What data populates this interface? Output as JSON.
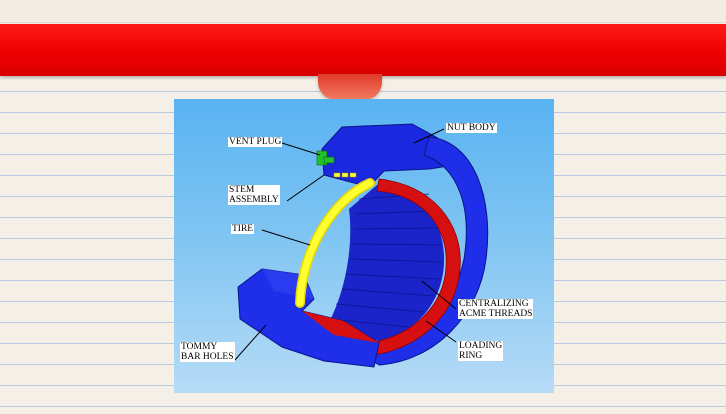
{
  "labels": {
    "vent_plug": "VENT PLUG",
    "nut_body": "NUT BODY",
    "stem_assembly": "STEM\nASSEMBLY",
    "tire": "TIRE",
    "centralizing_threads": "CENTRALIZING\nACME THREADS",
    "loading_ring": "LOADING\nRING",
    "tommy_bar_holes": "TOMMY\nBAR HOLES"
  },
  "colors": {
    "banner": "#ee0000",
    "nut_body": "#1f2ee8",
    "loading_ring": "#d61010",
    "tire": "#ffff22",
    "vent_plug": "#22c22a"
  }
}
